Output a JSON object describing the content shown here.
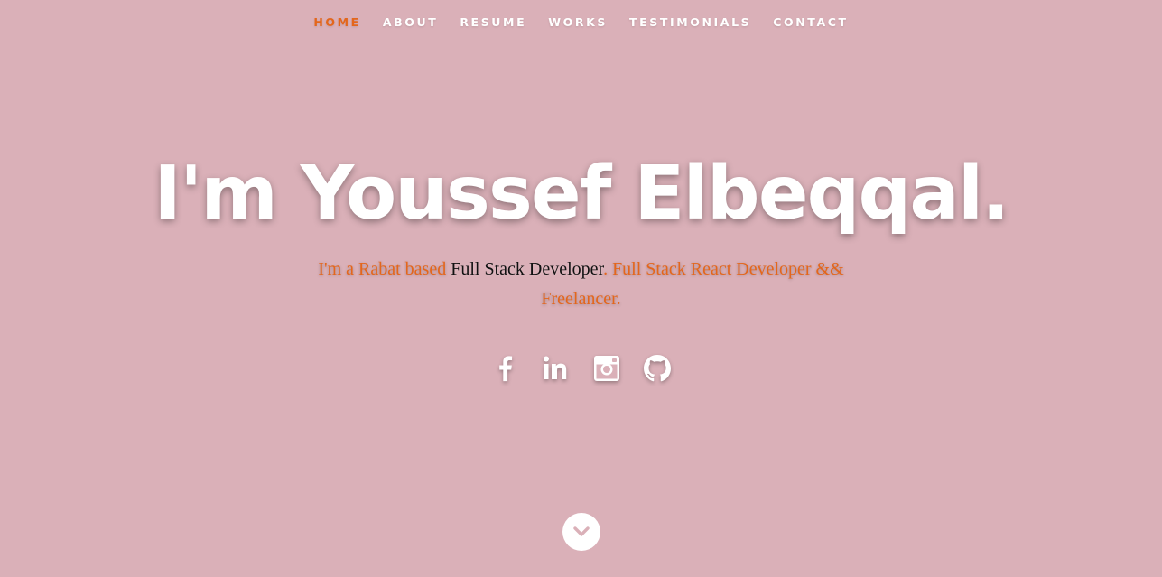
{
  "nav": {
    "items": [
      {
        "label": "HOME",
        "active": true
      },
      {
        "label": "ABOUT",
        "active": false
      },
      {
        "label": "RESUME",
        "active": false
      },
      {
        "label": "WORKS",
        "active": false
      },
      {
        "label": "TESTIMONIALS",
        "active": false
      },
      {
        "label": "CONTACT",
        "active": false
      }
    ]
  },
  "hero": {
    "headline": "I'm Youssef Elbeqqal.",
    "intro_prefix": "I'm a Rabat based ",
    "intro_role": "Full Stack Developer",
    "intro_suffix": ". Full Stack React Developer && Freelancer."
  },
  "social": [
    {
      "icon": "facebook-icon"
    },
    {
      "icon": "linkedin-icon"
    },
    {
      "icon": "instagram-icon"
    },
    {
      "icon": "github-icon"
    }
  ],
  "colors": {
    "background": "#dab0b8",
    "accent": "#e4661b",
    "text": "#ffffff",
    "role_text": "#111111"
  }
}
